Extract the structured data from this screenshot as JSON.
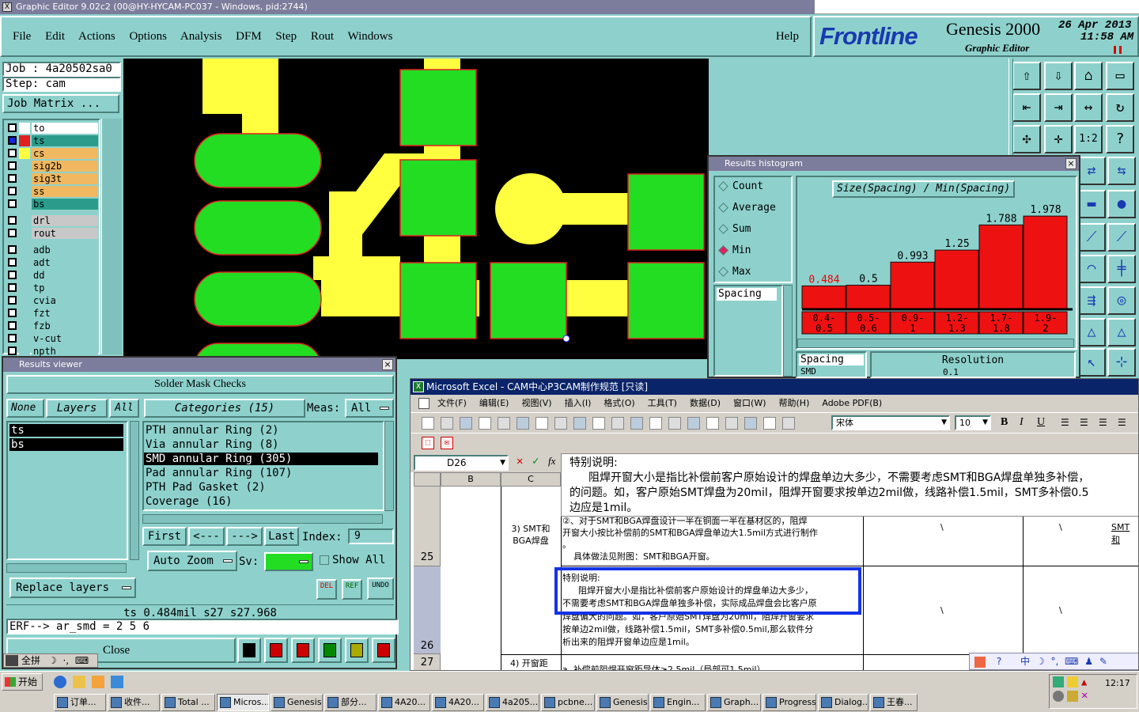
{
  "app": {
    "title": "Graphic Editor 9.02c2 (00@HY-HYCAM-PC037 - Windows, pid:2744)",
    "menu": [
      "File",
      "Edit",
      "Actions",
      "Options",
      "Analysis",
      "DFM",
      "Step",
      "Rout",
      "Windows"
    ],
    "help": "Help",
    "brand": "Frontline",
    "product": "Genesis 2000",
    "subtitle": "Graphic Editor",
    "date": "26 Apr 2013",
    "time": "11:58 AM"
  },
  "job": {
    "job_label": "Job : 4a20502sa0",
    "step_label": "Step: cam",
    "matrix_button": "Job Matrix ..."
  },
  "layers": [
    {
      "name": "to",
      "color": "#ffffff",
      "sw": "#ffffff"
    },
    {
      "name": "ts",
      "color": "#2b9c8c",
      "sw": "#e02020"
    },
    {
      "name": "cs",
      "color": "#f0b860",
      "sw": "#ffff40"
    },
    {
      "name": "sig2b",
      "color": "#f0b860",
      "sw": ""
    },
    {
      "name": "sig3t",
      "color": "#f0b860",
      "sw": ""
    },
    {
      "name": "ss",
      "color": "#f0b860",
      "sw": ""
    },
    {
      "name": "bs",
      "color": "#2b9c8c",
      "sw": ""
    },
    {
      "name": "drl",
      "color": "#c8c8c8",
      "sw": ""
    },
    {
      "name": "rout",
      "color": "#c8c8c8",
      "sw": ""
    },
    {
      "name": "adb",
      "color": "#8ed1cc",
      "sw": ""
    },
    {
      "name": "adt",
      "color": "#8ed1cc",
      "sw": ""
    },
    {
      "name": "dd",
      "color": "#8ed1cc",
      "sw": ""
    },
    {
      "name": "tp",
      "color": "#8ed1cc",
      "sw": ""
    },
    {
      "name": "cvia",
      "color": "#8ed1cc",
      "sw": ""
    },
    {
      "name": "fzt",
      "color": "#8ed1cc",
      "sw": ""
    },
    {
      "name": "fzb",
      "color": "#8ed1cc",
      "sw": ""
    },
    {
      "name": "v-cut",
      "color": "#8ed1cc",
      "sw": ""
    },
    {
      "name": "npth",
      "color": "#8ed1cc",
      "sw": ""
    }
  ],
  "histogram": {
    "title": "Results histogram",
    "options": [
      "Count",
      "Average",
      "Sum",
      "Min",
      "Max"
    ],
    "selected": "Min",
    "list_item": "Spacing",
    "list_item2": "SMD",
    "chart_title": "Size(Spacing) / Min(Spacing)",
    "values": [
      "0.484",
      "0.5",
      "0.993",
      "1.25",
      "1.788",
      "1.978"
    ],
    "bins": [
      "0.4-\n0.5",
      "0.5-\n0.6",
      "0.9-\n1",
      "1.2-\n1.3",
      "1.7-\n1.8",
      "1.9-\n2"
    ],
    "bottom_left": "Spacing",
    "bottom_right": "Resolution",
    "bottom_value": "0.1"
  },
  "chart_data": {
    "type": "bar",
    "title": "Size(Spacing) / Min(Spacing)",
    "categories": [
      "0.4-0.5",
      "0.5-0.6",
      "0.9-1",
      "1.2-1.3",
      "1.7-1.8",
      "1.9-2"
    ],
    "values": [
      0.484,
      0.5,
      0.993,
      1.25,
      1.788,
      1.978
    ],
    "ylim": [
      0,
      2.2
    ]
  },
  "results": {
    "title": "Results viewer",
    "header": "Solder Mask Checks",
    "none_btn": "None",
    "layers_btn": "Layers",
    "all_btn": "All",
    "categories_label": "Categories (15)",
    "meas_label": "Meas:",
    "meas_value": "All",
    "layer_list": [
      "ts",
      "bs"
    ],
    "categories": [
      "PTH annular Ring (2)",
      "Via annular Ring (8)",
      "SMD annular Ring (305)",
      "Pad annular Ring (107)",
      "PTH Pad Gasket (2)",
      "Coverage (16)"
    ],
    "selected_category": "SMD annular Ring (305)",
    "first": "First",
    "prev": "<---",
    "next": "--->",
    "last": "Last",
    "index_label": "Index:",
    "index_value": "9",
    "zoom": "Auto Zoom",
    "sv": "Sv:",
    "show_all": "Show All",
    "replace": "Replace layers",
    "del": "DEL",
    "ref": "REF",
    "undo": "UNDO",
    "status": "ts 0.484mil   s27   s27.968",
    "erf": "ERF--> ar_smd = 2 5 6",
    "close": "Close"
  },
  "excel": {
    "title": "Microsoft Excel - CAM中心P3CAM制作规范 [只读]",
    "menu": [
      "文件(F)",
      "编辑(E)",
      "视图(V)",
      "插入(I)",
      "格式(O)",
      "工具(T)",
      "数据(D)",
      "窗口(W)",
      "帮助(H)",
      "Adobe PDF(B)"
    ],
    "font": "宋体",
    "size": "10",
    "cell_ref": "D26",
    "formula_title": "特别说明:",
    "formula_text": "阻焊开窗大小是指比补偿前客户原始设计的焊盘单边大多少，不需要考虑SMT和BGA焊盘单独多补偿，",
    "formula_text2": "的问题。如，客户原始SMT焊盘为20mil，阻焊开窗要求按单边2mil做，线路补偿1.5mil，SMT多补偿0.5",
    "formula_text3": "边应是1mil。",
    "col_b": "B",
    "col_c": "C",
    "row25": "25",
    "row26": "26",
    "row27": "27",
    "c25": "3) SMT和BGA焊盘",
    "d25a": "②、对于SMT和BGA焊盘设计一半在铜面一半在基材区的，阻焊",
    "d25b": "开窗大小按比补偿前的SMT和BGA焊盘单边大1.5mil方式进行制作",
    "d25c": "。",
    "d25d": "具体做法见附图：SMT和BGA开窗。",
    "d26a": "特别说明:",
    "d26b": "阻焊开窗大小是指比补偿前客户原始设计的焊盘单边大多少，",
    "d26c": "不需要考虑SMT和BGA焊盘单独多补偿，实际成品焊盘会比客户原",
    "d26d": "焊盘偏大的问题。如，客户原始SMT焊盘为20mil，阻焊开窗要求",
    "d26e": "按单边2mil做，线路补偿1.5mil，SMT多补偿0.5mil,那么软件分",
    "d26f": "析出来的阻焊开窗单边应是1mil。",
    "c27": "4) 开窗距",
    "d27": "a. 补偿前阻焊开窗距导体≥2.5mil（局部可1.5mil）",
    "backslash": "\\",
    "smt": "SMT和"
  },
  "taskbar": {
    "start": "开始",
    "clock": "12:17",
    "items": [
      "订单...",
      "收件...",
      "Total ...",
      "Micros...",
      "Genesis",
      "部分...",
      "4A20...",
      "4A20...",
      "4a205...",
      "pcbne...",
      "Genesis",
      "Engin...",
      "Graph...",
      "Progress",
      "Dialog...",
      "王春..."
    ]
  },
  "ime": {
    "label": "全拼"
  }
}
